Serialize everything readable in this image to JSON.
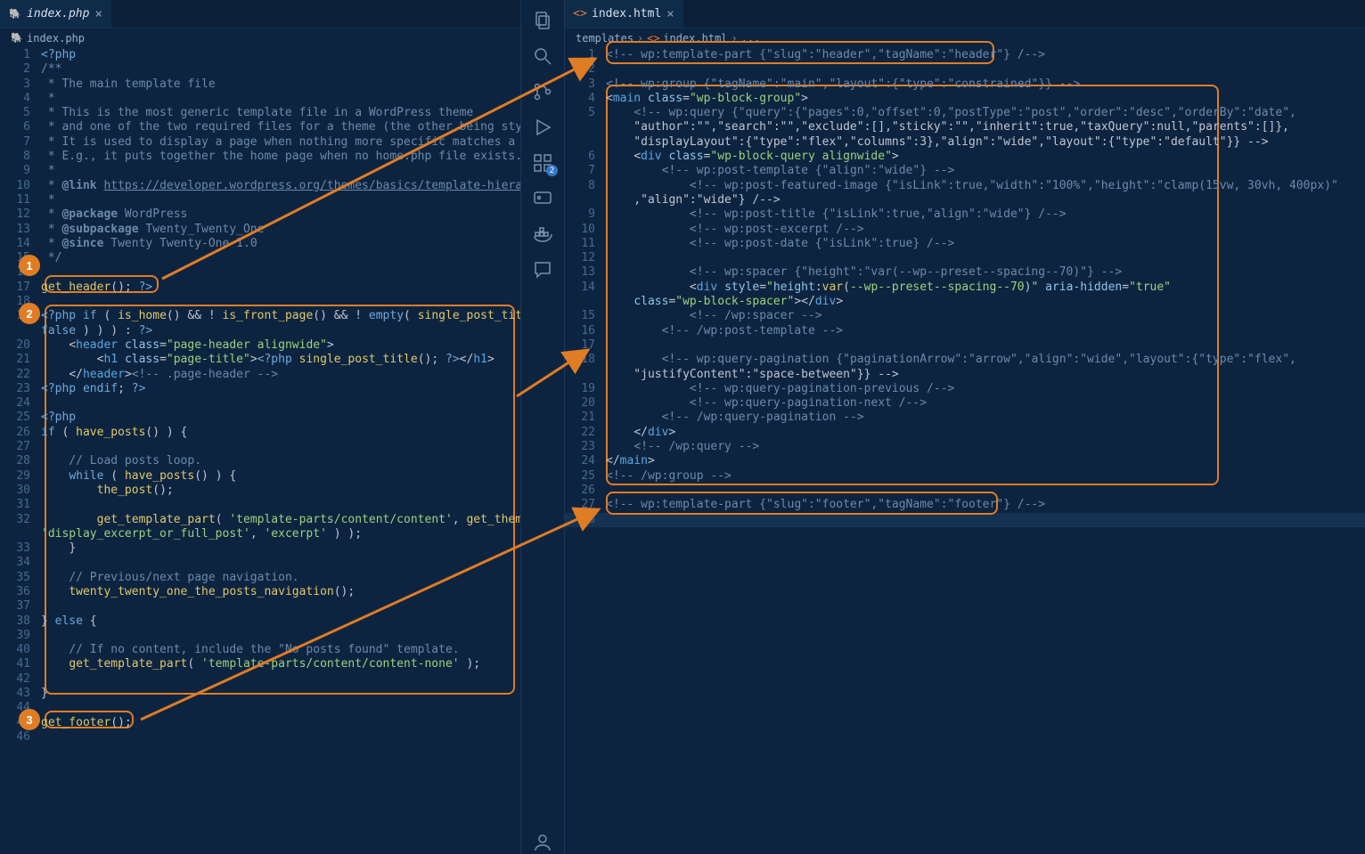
{
  "tabs": {
    "left": {
      "title": "index.php",
      "icon": "php"
    },
    "right": {
      "title": "index.html",
      "icon": "html"
    }
  },
  "crumbs": {
    "left": {
      "icon_label": "index.php"
    },
    "right": {
      "folder": "templates",
      "file": "index.html",
      "tail": "..."
    }
  },
  "activity": {
    "badge": "2"
  },
  "annotations": {
    "n1": "1",
    "n2": "2",
    "n3": "3"
  },
  "left_lines": [
    {
      "n": 1,
      "h": "<span class='c-phpdelim'>&lt;?php</span>"
    },
    {
      "n": 2,
      "h": "<span class='c-comment'>/**</span>"
    },
    {
      "n": 3,
      "h": "<span class='c-comment'> * The main template file</span>"
    },
    {
      "n": 4,
      "h": "<span class='c-comment'> *</span>"
    },
    {
      "n": 5,
      "h": "<span class='c-comment'> * This is the most generic template file in a WordPress theme</span>"
    },
    {
      "n": 6,
      "h": "<span class='c-comment'> * and one of the two required files for a theme (the other being style.css).</span>"
    },
    {
      "n": 7,
      "h": "<span class='c-comment'> * It is used to display a page when nothing more specific matches a query.</span>"
    },
    {
      "n": 8,
      "h": "<span class='c-comment'> * E.g., it puts together the home page when no home.php file exists.</span>"
    },
    {
      "n": 9,
      "h": "<span class='c-comment'> *</span>"
    },
    {
      "n": 10,
      "h": "<span class='c-comment'> * <span class='c-doctag'>@link</span> <span class='c-link'>https://developer.wordpress.org/themes/basics/template-hierarchy/</span></span>"
    },
    {
      "n": 11,
      "h": "<span class='c-comment'> *</span>"
    },
    {
      "n": 12,
      "h": "<span class='c-comment'> * <span class='c-doctag'>@package</span> WordPress</span>"
    },
    {
      "n": 13,
      "h": "<span class='c-comment'> * <span class='c-doctag'>@subpackage</span> Twenty_Twenty_One</span>"
    },
    {
      "n": 14,
      "h": "<span class='c-comment'> * <span class='c-doctag'>@since</span> Twenty Twenty-One 1.0</span>"
    },
    {
      "n": 15,
      "h": "<span class='c-comment'> */</span>"
    },
    {
      "n": 16,
      "h": ""
    },
    {
      "n": 17,
      "h": "<span class='c-fn'>get_header</span><span class='c-punc'>();</span> <span class='c-phpdelim'>?&gt;</span>"
    },
    {
      "n": 18,
      "h": ""
    },
    {
      "n": 19,
      "h": "<span class='c-phpdelim'>&lt;?php</span> <span class='c-kw'>if</span> <span class='c-punc'>(</span> <span class='c-fn'>is_home</span><span class='c-punc'>()</span> <span class='c-punc'>&amp;&amp;</span> <span class='c-punc'>!</span> <span class='c-fn'>is_front_page</span><span class='c-punc'>()</span> <span class='c-punc'>&amp;&amp;</span> <span class='c-punc'>!</span> <span class='c-kw'>empty</span><span class='c-punc'>(</span> <span class='c-fn'>single_post_title</span><span class='c-punc'>(</span> <span class='c-str'>''</span><span class='c-punc'>,</span> <span class='c-kw'>false</span> <span class='c-punc'>) ) ) :</span> <span class='c-phpdelim'>?&gt;</span>"
    },
    {
      "n": 20,
      "h": "    <span class='c-punc'>&lt;</span><span class='c-tag'>header</span> <span class='c-attr'>class</span>=<span class='c-str'>\"page-header alignwide\"</span><span class='c-punc'>&gt;</span>"
    },
    {
      "n": 21,
      "h": "        <span class='c-punc'>&lt;</span><span class='c-tag'>h1</span> <span class='c-attr'>class</span>=<span class='c-str'>\"page-title\"</span><span class='c-punc'>&gt;</span><span class='c-phpdelim'>&lt;?php</span> <span class='c-fn'>single_post_title</span><span class='c-punc'>();</span> <span class='c-phpdelim'>?&gt;</span><span class='c-punc'>&lt;/</span><span class='c-tag'>h1</span><span class='c-punc'>&gt;</span>"
    },
    {
      "n": 22,
      "h": "    <span class='c-punc'>&lt;/</span><span class='c-tag'>header</span><span class='c-punc'>&gt;</span><span class='c-html-comment'>&lt;!-- .page-header --&gt;</span>"
    },
    {
      "n": 23,
      "h": "<span class='c-phpdelim'>&lt;?php</span> <span class='c-kw'>endif</span><span class='c-punc'>;</span> <span class='c-phpdelim'>?&gt;</span>"
    },
    {
      "n": 24,
      "h": ""
    },
    {
      "n": 25,
      "h": "<span class='c-phpdelim'>&lt;?php</span>"
    },
    {
      "n": 26,
      "h": "<span class='c-kw'>if</span> <span class='c-punc'>(</span> <span class='c-fn'>have_posts</span><span class='c-punc'>() ) {</span>"
    },
    {
      "n": 27,
      "h": ""
    },
    {
      "n": 28,
      "h": "    <span class='c-comment'>// Load posts loop.</span>"
    },
    {
      "n": 29,
      "h": "    <span class='c-kw'>while</span> <span class='c-punc'>(</span> <span class='c-fn'>have_posts</span><span class='c-punc'>() ) {</span>"
    },
    {
      "n": 30,
      "h": "        <span class='c-fn'>the_post</span><span class='c-punc'>();</span>"
    },
    {
      "n": 31,
      "h": ""
    },
    {
      "n": 32,
      "h": "        <span class='c-fn'>get_template_part</span><span class='c-punc'>(</span> <span class='c-str'>'template-parts/content/content'</span><span class='c-punc'>,</span> <span class='c-fn'>get_theme_mod</span><span class='c-punc'>(</span> <span class='c-str'>'display_excerpt_or_full_post'</span><span class='c-punc'>,</span> <span class='c-str'>'excerpt'</span> <span class='c-punc'>) );</span>"
    },
    {
      "n": 33,
      "h": "    <span class='c-punc'>}</span>"
    },
    {
      "n": 34,
      "h": ""
    },
    {
      "n": 35,
      "h": "    <span class='c-comment'>// Previous/next page navigation.</span>"
    },
    {
      "n": 36,
      "h": "    <span class='c-fn'>twenty_twenty_one_the_posts_navigation</span><span class='c-punc'>();</span>"
    },
    {
      "n": 37,
      "h": ""
    },
    {
      "n": 38,
      "h": "<span class='c-punc'>}</span> <span class='c-kw'>else</span> <span class='c-punc'>{</span>"
    },
    {
      "n": 39,
      "h": ""
    },
    {
      "n": 40,
      "h": "    <span class='c-comment'>// If no content, include the \"No posts found\" template.</span>"
    },
    {
      "n": 41,
      "h": "    <span class='c-fn'>get_template_part</span><span class='c-punc'>(</span> <span class='c-str'>'template-parts/content/content-none'</span> <span class='c-punc'>);</span>"
    },
    {
      "n": 42,
      "h": ""
    },
    {
      "n": 43,
      "h": "<span class='c-punc'>}</span>"
    },
    {
      "n": 44,
      "h": ""
    },
    {
      "n": 45,
      "h": "<span class='c-fn'>get_footer</span><span class='c-punc'>();</span>"
    },
    {
      "n": 46,
      "h": ""
    }
  ],
  "right_lines": [
    {
      "n": 1,
      "h": "<span class='c-html-comment'>&lt;!-- wp:template-part {\"slug\":\"header\",\"tagName\":\"header\"} /--&gt;</span>"
    },
    {
      "n": 2,
      "h": ""
    },
    {
      "n": 3,
      "h": "<span class='c-html-comment'>&lt;!-- wp:group {\"tagName\":\"main\",\"layout\":{\"type\":\"constrained\"}} --&gt;</span>"
    },
    {
      "n": 4,
      "h": "<span class='c-punc'>&lt;</span><span class='c-tag'>main</span> <span class='c-attr'>class</span>=<span class='c-str'>\"wp-block-group\"</span><span class='c-punc'>&gt;</span>"
    },
    {
      "n": 5,
      "h": "    <span class='c-html-comment'>&lt;!-- wp:query {\"query\":{\"pages\":0,\"offset\":0,\"postType\":\"post\",\"order\":\"desc\",\"orderBy\":\"date\",\"author\":\"\",\"search\":\"\",\"exclude\":[],\"sticky\":\"\",\"inherit\":true,\"taxQuery\":null,\"parents\":[]},\"displayLayout\":{\"type\":\"flex\",\"columns\":3},\"align\":\"wide\",\"layout\":{\"type\":\"default\"}} --&gt;</span>"
    },
    {
      "n": 6,
      "h": "    <span class='c-punc'>&lt;</span><span class='c-tag'>div</span> <span class='c-attr'>class</span>=<span class='c-str'>\"wp-block-query alignwide\"</span><span class='c-punc'>&gt;</span>"
    },
    {
      "n": 7,
      "h": "        <span class='c-html-comment'>&lt;!-- wp:post-template {\"align\":\"wide\"} --&gt;</span>"
    },
    {
      "n": 8,
      "h": "            <span class='c-html-comment'>&lt;!-- wp:post-featured-image {\"isLink\":true,\"width\":\"100%\",\"height\":\"clamp(15vw, 30vh, 400px)\",\"align\":\"wide\"} /--&gt;</span>"
    },
    {
      "n": 9,
      "h": "            <span class='c-html-comment'>&lt;!-- wp:post-title {\"isLink\":true,\"align\":\"wide\"} /--&gt;</span>"
    },
    {
      "n": 10,
      "h": "            <span class='c-html-comment'>&lt;!-- wp:post-excerpt /--&gt;</span>"
    },
    {
      "n": 11,
      "h": "            <span class='c-html-comment'>&lt;!-- wp:post-date {\"isLink\":true} /--&gt;</span>"
    },
    {
      "n": 12,
      "h": ""
    },
    {
      "n": 13,
      "h": "            <span class='c-html-comment'>&lt;!-- wp:spacer {\"height\":\"var(--wp--preset--spacing--70)\"} --&gt;</span>"
    },
    {
      "n": 14,
      "h": "            <span class='c-punc'>&lt;</span><span class='c-tag'>div</span> <span class='c-attr'>style</span>=<span class='c-str'>\"</span><span class='c-prop'>height</span><span class='c-punc'>:</span><span class='c-fn'>var</span><span class='c-punc'>(</span><span class='c-val'>--wp--preset--spacing--70</span><span class='c-punc'>)</span><span class='c-str'>\"</span> <span class='c-attr'>aria-hidden</span>=<span class='c-str'>\"true\"</span> <span class='c-attr'>class</span>=<span class='c-str'>\"wp-block-spacer\"</span><span class='c-punc'>&gt;&lt;/</span><span class='c-tag'>div</span><span class='c-punc'>&gt;</span>"
    },
    {
      "n": 15,
      "h": "            <span class='c-html-comment'>&lt;!-- /wp:spacer --&gt;</span>"
    },
    {
      "n": 16,
      "h": "        <span class='c-html-comment'>&lt;!-- /wp:post-template --&gt;</span>"
    },
    {
      "n": 17,
      "h": ""
    },
    {
      "n": 18,
      "h": "        <span class='c-html-comment'>&lt;!-- wp:query-pagination {\"paginationArrow\":\"arrow\",\"align\":\"wide\",\"layout\":{\"type\":\"flex\",\"justifyContent\":\"space-between\"}} --&gt;</span>"
    },
    {
      "n": 19,
      "h": "            <span class='c-html-comment'>&lt;!-- wp:query-pagination-previous /--&gt;</span>"
    },
    {
      "n": 20,
      "h": "            <span class='c-html-comment'>&lt;!-- wp:query-pagination-next /--&gt;</span>"
    },
    {
      "n": 21,
      "h": "        <span class='c-html-comment'>&lt;!-- /wp:query-pagination --&gt;</span>"
    },
    {
      "n": 22,
      "h": "    <span class='c-punc'>&lt;/</span><span class='c-tag'>div</span><span class='c-punc'>&gt;</span>"
    },
    {
      "n": 23,
      "h": "    <span class='c-html-comment'>&lt;!-- /wp:query --&gt;</span>"
    },
    {
      "n": 24,
      "h": "<span class='c-punc'>&lt;/</span><span class='c-tag'>main</span><span class='c-punc'>&gt;</span>"
    },
    {
      "n": 25,
      "h": "<span class='c-html-comment'>&lt;!-- /wp:group --&gt;</span>"
    },
    {
      "n": 26,
      "h": ""
    },
    {
      "n": 27,
      "h": "<span class='c-html-comment'>&lt;!-- wp:template-part {\"slug\":\"footer\",\"tagName\":\"footer\"} /--&gt;</span>"
    },
    {
      "n": 28,
      "h": ""
    }
  ]
}
